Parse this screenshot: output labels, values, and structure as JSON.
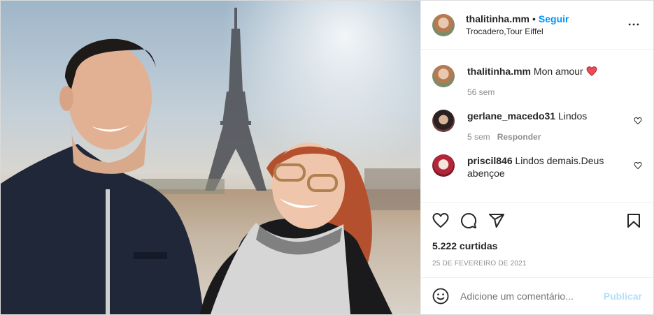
{
  "post": {
    "username": "thalitinha.mm",
    "follow_label": "Seguir",
    "location": "Trocadero,Tour Eiffel",
    "more_icon": "more-horizontal-icon"
  },
  "comments": [
    {
      "username": "thalitinha.mm",
      "text": "Mon amour",
      "time": "56 sem",
      "emoji": "red-heart"
    },
    {
      "username": "gerlane_macedo31",
      "text": "Lindos",
      "time": "5 sem",
      "reply": "Responder"
    },
    {
      "username": "priscil846",
      "text": "Lindos demais.Deus abençoe"
    }
  ],
  "actions": {
    "likes": "5.222 curtidas",
    "date": "25 DE FEVEREIRO DE 2021"
  },
  "add_comment": {
    "placeholder": "Adicione um comentário...",
    "publish_label": "Publicar"
  },
  "colors": {
    "accent": "#0095f6",
    "publish_disabled": "#b2dffc",
    "muted": "#8e8e8e",
    "heart": "#ed4956"
  }
}
